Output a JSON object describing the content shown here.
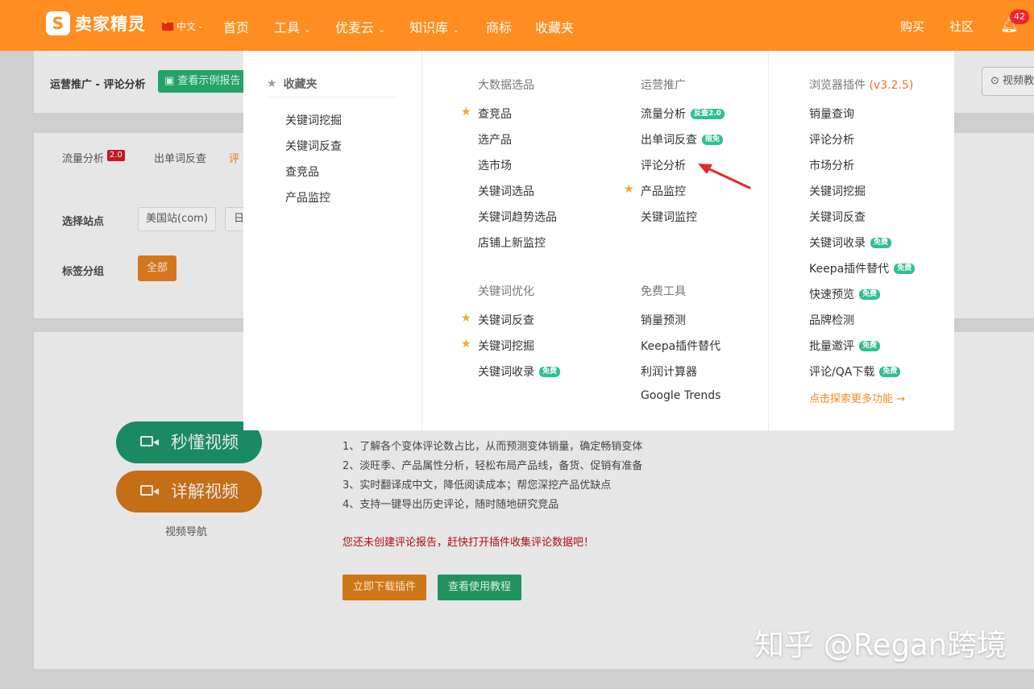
{
  "topbar": {
    "logo_mark": "S",
    "logo_text": "卖家精灵",
    "language": "中文",
    "nav": [
      "首页",
      "工具",
      "优麦云",
      "知识库",
      "商标",
      "收藏夹"
    ],
    "nav_right": [
      "购买",
      "社区"
    ],
    "notification_count": "42",
    "colors": {
      "brand": "#ff8d1f"
    }
  },
  "page": {
    "breadcrumb": "运营推广 - 评论分析",
    "sample_report_button": "查看示例报告",
    "video_tutorial_button": "视频教",
    "tabs": [
      {
        "label": "流量分析",
        "badge": "2.0"
      },
      {
        "label": "出单词反查"
      }
    ],
    "active_tab": "评",
    "site_label": "选择站点",
    "site_value": "美国站(com)",
    "site_value2": "日",
    "tag_group_label": "标签分组",
    "tag_group_all": "全部",
    "video_buttons": [
      "秒懂视频",
      "详解视频"
    ],
    "video_nav": "视频导航",
    "features": [
      "1、了解各个变体评论数占比，从而预测变体销量，确定畅销变体",
      "2、淡旺季、产品属性分析，轻松布局产品线，备货、促销有准备",
      "3、实时翻译成中文，降低阅读成本；帮您深挖产品优缺点",
      "4、支持一键导出历史评论，随时随地研究竞品"
    ],
    "warning": "您还未创建评论报告，赶快打开插件收集评论数据吧！",
    "download_plugin_button": "立即下载插件",
    "tutorial_button": "查看使用教程"
  },
  "dropdown": {
    "favorites": {
      "title": "收藏夹",
      "items": [
        "关键词挖掘",
        "关键词反查",
        "查竞品",
        "产品监控"
      ]
    },
    "big_data": {
      "title": "大数据选品",
      "items": [
        {
          "label": "查竞品",
          "star": true
        },
        {
          "label": "选产品"
        },
        {
          "label": "选市场"
        },
        {
          "label": "关键词选品"
        },
        {
          "label": "关键词趋势选品"
        },
        {
          "label": "店铺上新监控"
        }
      ]
    },
    "keyword_opt": {
      "title": "关键词优化",
      "items": [
        {
          "label": "关键词反查",
          "star": true
        },
        {
          "label": "关键词挖掘",
          "star": true
        },
        {
          "label": "关键词收录",
          "tag": "免费"
        }
      ]
    },
    "ops": {
      "title": "运营推广",
      "items": [
        {
          "label": "流量分析",
          "tag": "反查2.0"
        },
        {
          "label": "出单词反查",
          "tag": "限免"
        },
        {
          "label": "评论分析"
        },
        {
          "label": "产品监控",
          "star": true
        },
        {
          "label": "关键词监控"
        }
      ]
    },
    "free_tools": {
      "title": "免费工具",
      "items": [
        "销量预测",
        "Keepa插件替代",
        "利润计算器",
        "Google Trends"
      ]
    },
    "plugin": {
      "title": "浏览器插件",
      "version": "(v3.2.5)",
      "items": [
        {
          "label": "销量查询"
        },
        {
          "label": "评论分析"
        },
        {
          "label": "市场分析"
        },
        {
          "label": "关键词挖掘"
        },
        {
          "label": "关键词反查"
        },
        {
          "label": "关键词收录",
          "tag": "免费"
        },
        {
          "label": "Keepa插件替代",
          "tag": "免费"
        },
        {
          "label": "快速预览",
          "tag": "免费"
        },
        {
          "label": "品牌检测"
        },
        {
          "label": "批量邀评",
          "tag": "免费"
        },
        {
          "label": "评论/QA下载",
          "tag": "免费"
        }
      ],
      "more": "点击探索更多功能 →"
    }
  },
  "watermark": "知乎 @Regan跨境"
}
